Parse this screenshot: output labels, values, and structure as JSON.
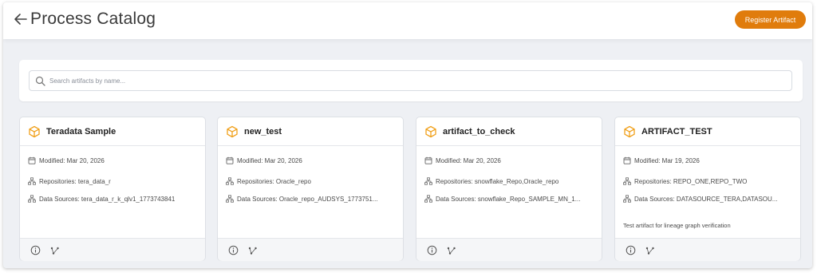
{
  "header": {
    "title": "Process Catalog",
    "register_label": "Register Artifact",
    "accent_color": "#e07c0c"
  },
  "search": {
    "placeholder": "Search artifacts by name...",
    "value": ""
  },
  "cards": [
    {
      "title": "Teradata Sample",
      "modified": "Modified: Mar 20, 2026",
      "repositories": "Repositories: tera_data_r",
      "data_sources": "Data Sources: tera_data_r_k_qlv1_1773743841",
      "description": ""
    },
    {
      "title": "new_test",
      "modified": "Modified: Mar 20, 2026",
      "repositories": "Repositories: Oracle_repo",
      "data_sources": "Data Sources: Oracle_repo_AUDSYS_1773751...",
      "description": ""
    },
    {
      "title": "artifact_to_check",
      "modified": "Modified: Mar 20, 2026",
      "repositories": "Repositories: snowflake_Repo,Oracle_repo",
      "data_sources": "Data Sources: snowflake_Repo_SAMPLE_MN_1...",
      "description": ""
    },
    {
      "title": "ARTIFACT_TEST",
      "modified": "Modified: Mar 19, 2026",
      "repositories": "Repositories: REPO_ONE,REPO_TWO",
      "data_sources": "Data Sources: DATASOURCE_TERA,DATASOU...",
      "description": "Test artifact for lineage graph verification"
    }
  ],
  "icons": {
    "back": "arrow-left-icon",
    "search": "search-icon",
    "card": "cube-icon",
    "modified": "calendar-icon",
    "repositories": "hierarchy-icon",
    "data_sources": "hierarchy-icon",
    "info": "info-icon",
    "lineage": "lineage-icon"
  }
}
